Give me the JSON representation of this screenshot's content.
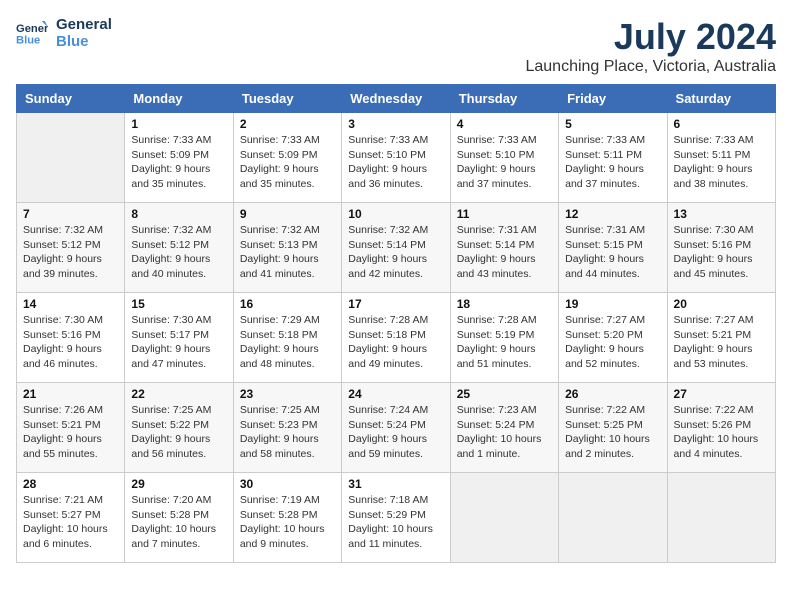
{
  "header": {
    "logo_line1": "General",
    "logo_line2": "Blue",
    "month": "July 2024",
    "location": "Launching Place, Victoria, Australia"
  },
  "days_of_week": [
    "Sunday",
    "Monday",
    "Tuesday",
    "Wednesday",
    "Thursday",
    "Friday",
    "Saturday"
  ],
  "weeks": [
    [
      {
        "day": "",
        "sunrise": "",
        "sunset": "",
        "daylight": ""
      },
      {
        "day": "1",
        "sunrise": "Sunrise: 7:33 AM",
        "sunset": "Sunset: 5:09 PM",
        "daylight": "Daylight: 9 hours and 35 minutes."
      },
      {
        "day": "2",
        "sunrise": "Sunrise: 7:33 AM",
        "sunset": "Sunset: 5:09 PM",
        "daylight": "Daylight: 9 hours and 35 minutes."
      },
      {
        "day": "3",
        "sunrise": "Sunrise: 7:33 AM",
        "sunset": "Sunset: 5:10 PM",
        "daylight": "Daylight: 9 hours and 36 minutes."
      },
      {
        "day": "4",
        "sunrise": "Sunrise: 7:33 AM",
        "sunset": "Sunset: 5:10 PM",
        "daylight": "Daylight: 9 hours and 37 minutes."
      },
      {
        "day": "5",
        "sunrise": "Sunrise: 7:33 AM",
        "sunset": "Sunset: 5:11 PM",
        "daylight": "Daylight: 9 hours and 37 minutes."
      },
      {
        "day": "6",
        "sunrise": "Sunrise: 7:33 AM",
        "sunset": "Sunset: 5:11 PM",
        "daylight": "Daylight: 9 hours and 38 minutes."
      }
    ],
    [
      {
        "day": "7",
        "sunrise": "Sunrise: 7:32 AM",
        "sunset": "Sunset: 5:12 PM",
        "daylight": "Daylight: 9 hours and 39 minutes."
      },
      {
        "day": "8",
        "sunrise": "Sunrise: 7:32 AM",
        "sunset": "Sunset: 5:12 PM",
        "daylight": "Daylight: 9 hours and 40 minutes."
      },
      {
        "day": "9",
        "sunrise": "Sunrise: 7:32 AM",
        "sunset": "Sunset: 5:13 PM",
        "daylight": "Daylight: 9 hours and 41 minutes."
      },
      {
        "day": "10",
        "sunrise": "Sunrise: 7:32 AM",
        "sunset": "Sunset: 5:14 PM",
        "daylight": "Daylight: 9 hours and 42 minutes."
      },
      {
        "day": "11",
        "sunrise": "Sunrise: 7:31 AM",
        "sunset": "Sunset: 5:14 PM",
        "daylight": "Daylight: 9 hours and 43 minutes."
      },
      {
        "day": "12",
        "sunrise": "Sunrise: 7:31 AM",
        "sunset": "Sunset: 5:15 PM",
        "daylight": "Daylight: 9 hours and 44 minutes."
      },
      {
        "day": "13",
        "sunrise": "Sunrise: 7:30 AM",
        "sunset": "Sunset: 5:16 PM",
        "daylight": "Daylight: 9 hours and 45 minutes."
      }
    ],
    [
      {
        "day": "14",
        "sunrise": "Sunrise: 7:30 AM",
        "sunset": "Sunset: 5:16 PM",
        "daylight": "Daylight: 9 hours and 46 minutes."
      },
      {
        "day": "15",
        "sunrise": "Sunrise: 7:30 AM",
        "sunset": "Sunset: 5:17 PM",
        "daylight": "Daylight: 9 hours and 47 minutes."
      },
      {
        "day": "16",
        "sunrise": "Sunrise: 7:29 AM",
        "sunset": "Sunset: 5:18 PM",
        "daylight": "Daylight: 9 hours and 48 minutes."
      },
      {
        "day": "17",
        "sunrise": "Sunrise: 7:28 AM",
        "sunset": "Sunset: 5:18 PM",
        "daylight": "Daylight: 9 hours and 49 minutes."
      },
      {
        "day": "18",
        "sunrise": "Sunrise: 7:28 AM",
        "sunset": "Sunset: 5:19 PM",
        "daylight": "Daylight: 9 hours and 51 minutes."
      },
      {
        "day": "19",
        "sunrise": "Sunrise: 7:27 AM",
        "sunset": "Sunset: 5:20 PM",
        "daylight": "Daylight: 9 hours and 52 minutes."
      },
      {
        "day": "20",
        "sunrise": "Sunrise: 7:27 AM",
        "sunset": "Sunset: 5:21 PM",
        "daylight": "Daylight: 9 hours and 53 minutes."
      }
    ],
    [
      {
        "day": "21",
        "sunrise": "Sunrise: 7:26 AM",
        "sunset": "Sunset: 5:21 PM",
        "daylight": "Daylight: 9 hours and 55 minutes."
      },
      {
        "day": "22",
        "sunrise": "Sunrise: 7:25 AM",
        "sunset": "Sunset: 5:22 PM",
        "daylight": "Daylight: 9 hours and 56 minutes."
      },
      {
        "day": "23",
        "sunrise": "Sunrise: 7:25 AM",
        "sunset": "Sunset: 5:23 PM",
        "daylight": "Daylight: 9 hours and 58 minutes."
      },
      {
        "day": "24",
        "sunrise": "Sunrise: 7:24 AM",
        "sunset": "Sunset: 5:24 PM",
        "daylight": "Daylight: 9 hours and 59 minutes."
      },
      {
        "day": "25",
        "sunrise": "Sunrise: 7:23 AM",
        "sunset": "Sunset: 5:24 PM",
        "daylight": "Daylight: 10 hours and 1 minute."
      },
      {
        "day": "26",
        "sunrise": "Sunrise: 7:22 AM",
        "sunset": "Sunset: 5:25 PM",
        "daylight": "Daylight: 10 hours and 2 minutes."
      },
      {
        "day": "27",
        "sunrise": "Sunrise: 7:22 AM",
        "sunset": "Sunset: 5:26 PM",
        "daylight": "Daylight: 10 hours and 4 minutes."
      }
    ],
    [
      {
        "day": "28",
        "sunrise": "Sunrise: 7:21 AM",
        "sunset": "Sunset: 5:27 PM",
        "daylight": "Daylight: 10 hours and 6 minutes."
      },
      {
        "day": "29",
        "sunrise": "Sunrise: 7:20 AM",
        "sunset": "Sunset: 5:28 PM",
        "daylight": "Daylight: 10 hours and 7 minutes."
      },
      {
        "day": "30",
        "sunrise": "Sunrise: 7:19 AM",
        "sunset": "Sunset: 5:28 PM",
        "daylight": "Daylight: 10 hours and 9 minutes."
      },
      {
        "day": "31",
        "sunrise": "Sunrise: 7:18 AM",
        "sunset": "Sunset: 5:29 PM",
        "daylight": "Daylight: 10 hours and 11 minutes."
      },
      {
        "day": "",
        "sunrise": "",
        "sunset": "",
        "daylight": ""
      },
      {
        "day": "",
        "sunrise": "",
        "sunset": "",
        "daylight": ""
      },
      {
        "day": "",
        "sunrise": "",
        "sunset": "",
        "daylight": ""
      }
    ]
  ]
}
